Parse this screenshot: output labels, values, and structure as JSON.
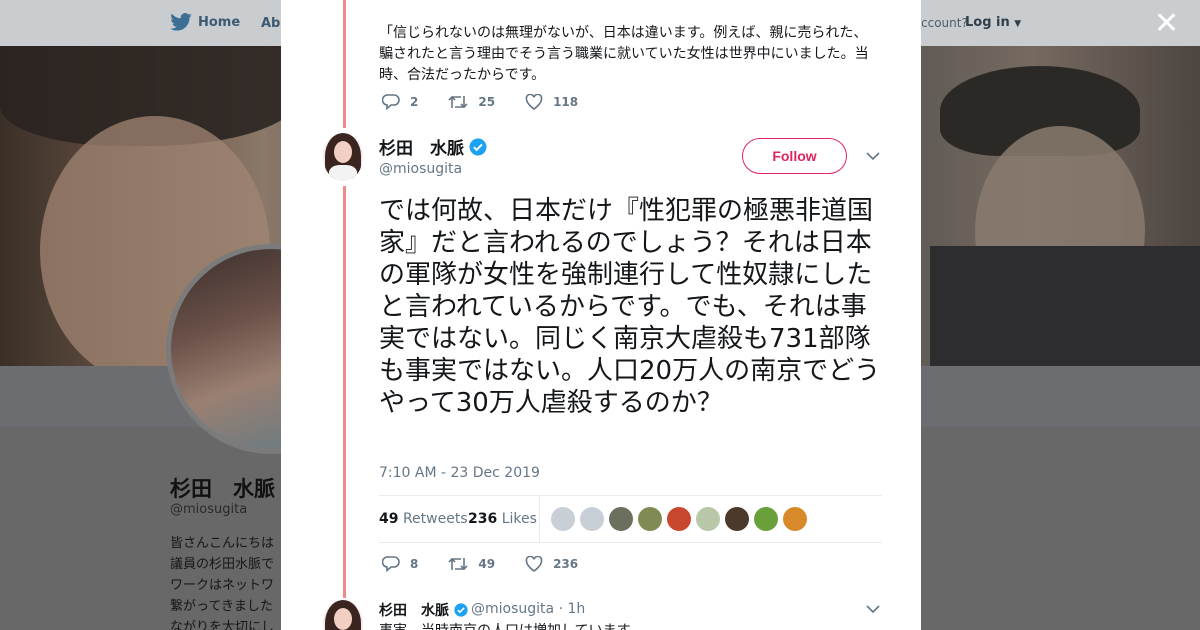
{
  "background": {
    "nav": {
      "home": "Home",
      "about": "Abo",
      "account_prompt": "ccount?",
      "login": "Log in"
    },
    "profile": {
      "name": "杉田　水脈",
      "handle": "@miosugita",
      "bio_lines": [
        "皆さんこんにちは",
        "議員の杉田水脈で",
        "ワークはネットワ",
        "繋がってきました",
        "ながりを大切にし"
      ]
    }
  },
  "modal": {
    "parent_tweet": {
      "text": "「信じられないのは無理がないが、日本は違います。例えば、親に売られた、騙されたと言う理由でそう言う職業に就いていた女性は世界中にいました。当時、合法だったからです。",
      "replies": "2",
      "retweets": "25",
      "likes": "118"
    },
    "main_tweet": {
      "author_name": "杉田　水脈",
      "handle": "@miosugita",
      "follow_label": "Follow",
      "text": "では何故、日本だけ『性犯罪の極悪非道国家』だと言われるのでしょう？それは日本の軍隊が女性を強制連行して性奴隷にしたと言われているからです。でも、それは事実ではない。同じく南京大虐殺も731部隊も事実ではない。人口20万人の南京でどうやって30万人虐殺するのか？",
      "timestamp": "7:10 AM - 23 Dec 2019",
      "retweets_count": "49",
      "retweets_label": "Retweets",
      "likes_count": "236",
      "likes_label": "Likes",
      "replies": "8",
      "retweets": "49",
      "likes": "236",
      "liker_colors": [
        "#c9cfd6",
        "#c9cfd6",
        "#6b6f5d",
        "#7f8a55",
        "#c8472f",
        "#b8c7a7",
        "#4b3a2b",
        "#6aa03a",
        "#d88a2a"
      ]
    },
    "reply_tweet": {
      "author_name": "杉田　水脈",
      "handle": "@miosugita",
      "time": "· 1h",
      "text": "事実、当時南京の人口は増加しています。"
    }
  },
  "colors": {
    "accent": "#e0245e",
    "thread": "#f08a8a",
    "verified": "#1da1f2"
  }
}
